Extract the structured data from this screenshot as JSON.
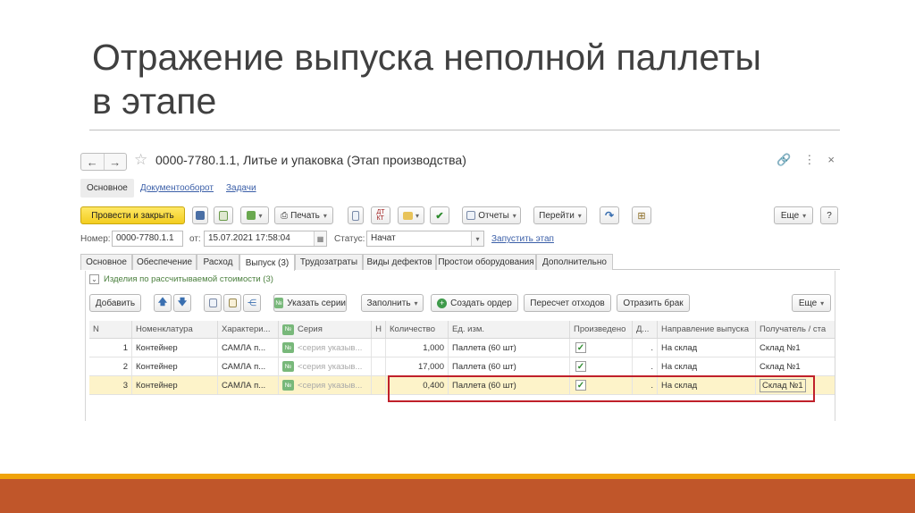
{
  "slide": {
    "title_line1": "Отражение выпуска неполной паллеты",
    "title_line2": "в этапе"
  },
  "window": {
    "title": "0000-7780.1.1, Литье и упаковка (Этап производства)",
    "nav_back": "←",
    "nav_forward": "→",
    "star": "☆",
    "link_icon": "🔗",
    "more_icon": "⋮",
    "close_icon": "×"
  },
  "top_tabs": {
    "main": "Основное",
    "docflow": "Документооборот",
    "tasks": "Задачи"
  },
  "toolbar": {
    "post_close": "Провести и закрыть",
    "print": "Печать",
    "reports": "Отчеты",
    "goto": "Перейти",
    "more": "Еще",
    "help": "?"
  },
  "fields": {
    "number_label": "Номер:",
    "number_value": "0000-7780.1.1",
    "date_label": "от:",
    "date_value": "15.07.2021 17:58:04",
    "status_label": "Статус:",
    "status_value": "Начат",
    "start_stage_link": "Запустить этап"
  },
  "tabs": [
    "Основное",
    "Обеспечение",
    "Расход",
    "Выпуск (3)",
    "Трудозатраты",
    "Виды дефектов",
    "Простои оборудования",
    "Дополнительно"
  ],
  "panel": {
    "group_title": "Изделия по рассчитываемой стоимости (3)",
    "add": "Добавить",
    "specify_series": "Указать серии",
    "fill": "Заполнить",
    "create_order": "Создать ордер",
    "recalc_waste": "Пересчет отходов",
    "reflect_defect": "Отразить брак",
    "more": "Еще"
  },
  "table": {
    "headers": {
      "n": "N",
      "item": "Номенклатура",
      "characteristic": "Характери...",
      "series": "Серия",
      "h": "Н",
      "qty": "Количество",
      "unit": "Ед. изм.",
      "produced": "Произведено",
      "d": "Д...",
      "direction": "Направление выпуска",
      "recipient": "Получатель / ста"
    },
    "rows": [
      {
        "n": "1",
        "item": "Контейнер",
        "characteristic": "САМЛА п...",
        "series": "<серия указыв...",
        "qty": "1,000",
        "unit": "Паллета (60 шт)",
        "produced": true,
        "d": ".",
        "direction": "На склад",
        "recipient": "Склад №1"
      },
      {
        "n": "2",
        "item": "Контейнер",
        "characteristic": "САМЛА п...",
        "series": "<серия указыв...",
        "qty": "17,000",
        "unit": "Паллета (60 шт)",
        "produced": true,
        "d": ".",
        "direction": "На склад",
        "recipient": "Склад №1"
      },
      {
        "n": "3",
        "item": "Контейнер",
        "characteristic": "САМЛА п...",
        "series": "<серия указыв...",
        "qty": "0,400",
        "unit": "Паллета (60 шт)",
        "produced": true,
        "d": ".",
        "direction": "На склад",
        "recipient": "Склад №1"
      }
    ]
  },
  "colors": {
    "primary_button": "#f3cd1f",
    "selected_row": "#fdf3c9",
    "highlight_border": "#c0202a",
    "footer_orange": "#f0a30a",
    "footer_brown": "#c0562a"
  }
}
